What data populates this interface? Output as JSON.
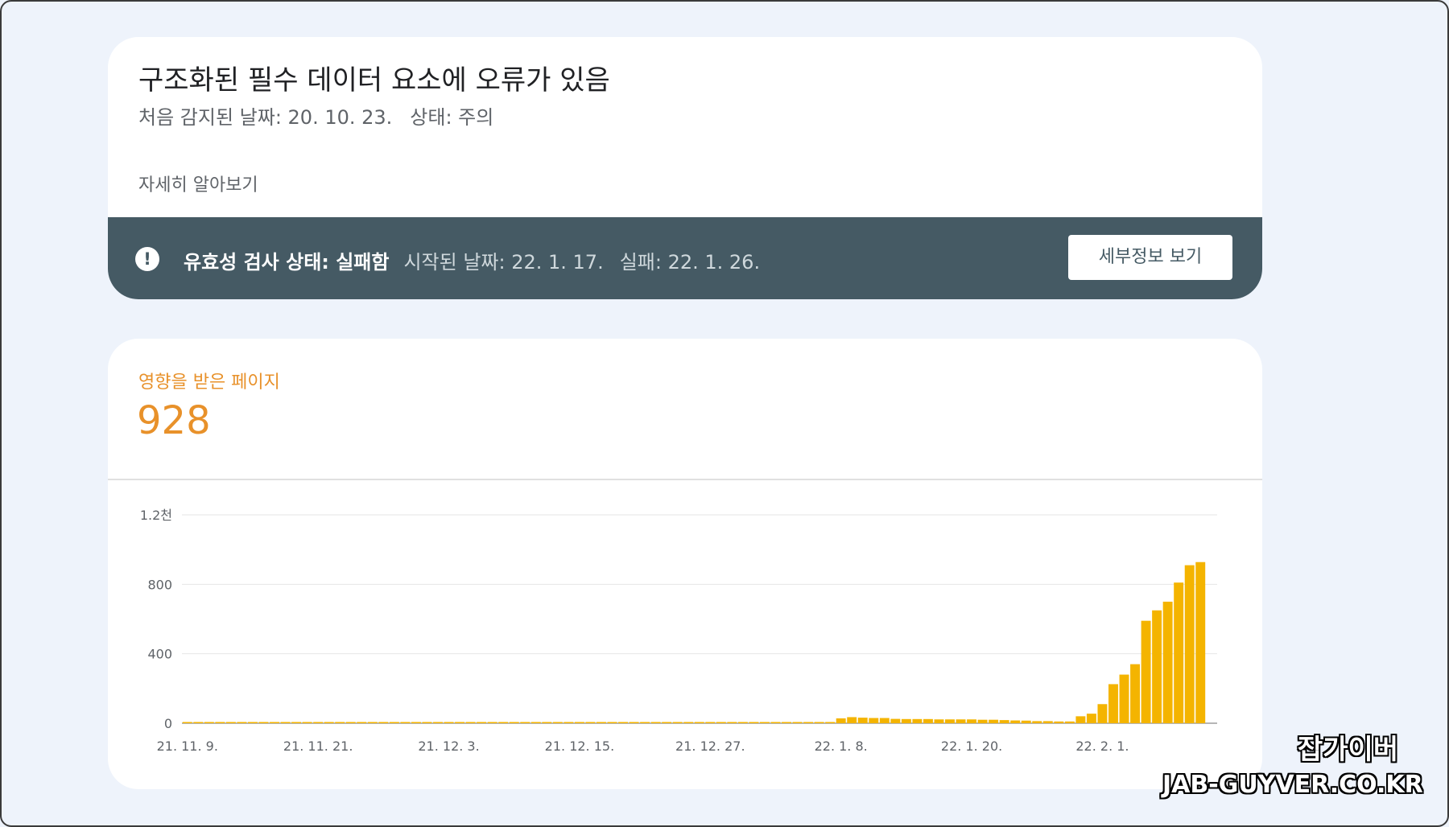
{
  "header": {
    "title": "구조화된 필수 데이터 요소에 오류가 있음",
    "first_detected": "처음 감지된 날짜: 20. 10. 23.",
    "status": "상태: 주의",
    "learn_more": "자세히 알아보기"
  },
  "banner": {
    "icon": "alert-icon",
    "status_label": "유효성 검사 상태: 실패함",
    "started": "시작된 날짜: 22. 1. 17.",
    "failed": "실패: 22. 1. 26.",
    "details_button": "세부정보 보기"
  },
  "metric": {
    "label": "영향을 받은 페이지",
    "value": "928",
    "color": "#e8912a"
  },
  "colors": {
    "banner_bg": "#455a64",
    "bar": "#f4b400",
    "background": "#eef3fb"
  },
  "chart_data": {
    "type": "bar",
    "x_ticks": [
      "21. 11. 9.",
      "21. 11. 21.",
      "21. 12. 3.",
      "21. 12. 15.",
      "21. 12. 27.",
      "22. 1. 8.",
      "22. 1. 20.",
      "22. 2. 1."
    ],
    "y_ticks": [
      "0",
      "400",
      "800",
      "1.2천"
    ],
    "ylim": [
      0,
      1200
    ],
    "x_start": "21. 11. 9.",
    "values": [
      0,
      0,
      0,
      0,
      0,
      0,
      0,
      0,
      0,
      0,
      0,
      0,
      0,
      0,
      0,
      0,
      0,
      0,
      0,
      0,
      0,
      0,
      0,
      0,
      0,
      0,
      0,
      0,
      0,
      0,
      0,
      0,
      0,
      0,
      0,
      0,
      0,
      0,
      0,
      0,
      0,
      0,
      0,
      0,
      0,
      0,
      0,
      0,
      0,
      0,
      0,
      0,
      0,
      0,
      0,
      0,
      0,
      0,
      0,
      0,
      28,
      35,
      32,
      30,
      30,
      25,
      24,
      24,
      24,
      22,
      22,
      22,
      22,
      20,
      20,
      18,
      16,
      15,
      12,
      12,
      10,
      10,
      40,
      55,
      110,
      225,
      280,
      340,
      590,
      650,
      700,
      810,
      910,
      928
    ],
    "grid": true,
    "legend": "none"
  },
  "watermark": {
    "kr": "잡가이버",
    "en": "JAB-GUYVER.CO.KR"
  }
}
